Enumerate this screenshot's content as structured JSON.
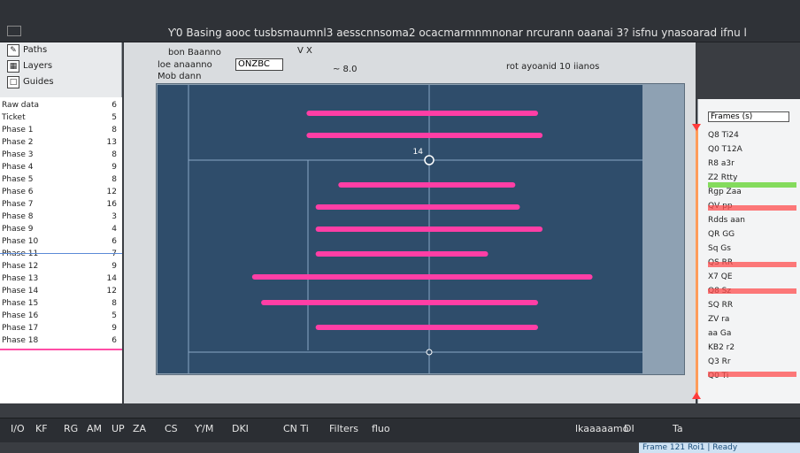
{
  "window": {
    "title": "Ƴ0 Basing aooc tusbsmaumnl3 aesscnnsoma2 ocacmarmnmnonar nrcurann oaanai 3? isfnu ynasoarad ifnu l"
  },
  "toolbar": {
    "items": [
      {
        "icon": "pencil-icon",
        "label": "Paths"
      },
      {
        "icon": "grid-icon",
        "label": "Layers"
      },
      {
        "icon": "square-icon",
        "label": "Guides"
      }
    ]
  },
  "leftlist": {
    "rows": [
      {
        "label": "Raw data",
        "value": "6"
      },
      {
        "label": "Ticket",
        "value": "5"
      },
      {
        "label": "Phase 1",
        "value": "8"
      },
      {
        "label": "Phase 2",
        "value": "13"
      },
      {
        "label": "Phase 3",
        "value": "8"
      },
      {
        "label": "Phase 4",
        "value": "9"
      },
      {
        "label": "Phase 5",
        "value": "8"
      },
      {
        "label": "Phase 6",
        "value": "12"
      },
      {
        "label": "Phase 7",
        "value": "16"
      },
      {
        "label": "Phase 8",
        "value": "3"
      },
      {
        "label": "Phase 9",
        "value": "4"
      },
      {
        "label": "Phase 10",
        "value": "6"
      },
      {
        "label": "Phase 11",
        "value": "7"
      },
      {
        "label": "Phase 12",
        "value": "9"
      },
      {
        "label": "Phase 13",
        "value": "14"
      },
      {
        "label": "Phase 14",
        "value": "12"
      },
      {
        "label": "Phase 15",
        "value": "8"
      },
      {
        "label": "Phase 16",
        "value": "5"
      },
      {
        "label": "Phase 17",
        "value": "9"
      },
      {
        "label": "Phase 18",
        "value": "6"
      }
    ]
  },
  "header": {
    "line1": "bon Baanno",
    "line2": "loe anaanno",
    "line3": "Mob dann",
    "field_value": "ONZBC",
    "field_label": "V X",
    "counter": "~ 8.0",
    "side_text": "rot ayoanid 10 iianos"
  },
  "chart_data": {
    "type": "bar",
    "categories": [
      "",
      "",
      "",
      "",
      "",
      "",
      "",
      "",
      "",
      ""
    ],
    "series": [
      {
        "values": [
          [
            26,
            77
          ],
          [
            26,
            78
          ],
          [
            33,
            72
          ],
          [
            28,
            73
          ],
          [
            28,
            78
          ],
          [
            28,
            66
          ],
          [
            14,
            89
          ],
          [
            16,
            77
          ],
          [
            28,
            77
          ]
        ]
      }
    ],
    "orientation": "horizontal",
    "xlim": [
      0,
      100
    ],
    "annotation": "14"
  },
  "rightpanel": {
    "rows": [
      "Frames (s)",
      "Q8 Ti24",
      "Q0 T12A",
      "R8 a3r",
      "Z2 Rtty",
      "Rgp Zaa",
      "QV pp",
      "Rdds aan",
      "QR GG",
      "Sq Gs",
      "QS RR",
      "X7 QE",
      "Q8 Sz",
      "SQ RR",
      "ZV ra",
      "aa Ga",
      "KB2 r2",
      "Q3 Rr",
      "Q0 Ti"
    ]
  },
  "bottombar": {
    "items": [
      "I/O",
      "KF",
      "RG",
      "AM",
      "UP",
      "ZA",
      "CS",
      "Ƴ/M",
      "DKI",
      "CN Ti",
      "Filters",
      "fluo",
      "lkaaaaamo",
      "DI",
      "Ta"
    ],
    "status": "Frame 121 Roi1 | Ready"
  },
  "colors": {
    "bar": "#ff3ea5",
    "chart_bg": "#2f4d6b",
    "accent_green": "#5fd32a",
    "accent_red": "#ff4d4d"
  }
}
